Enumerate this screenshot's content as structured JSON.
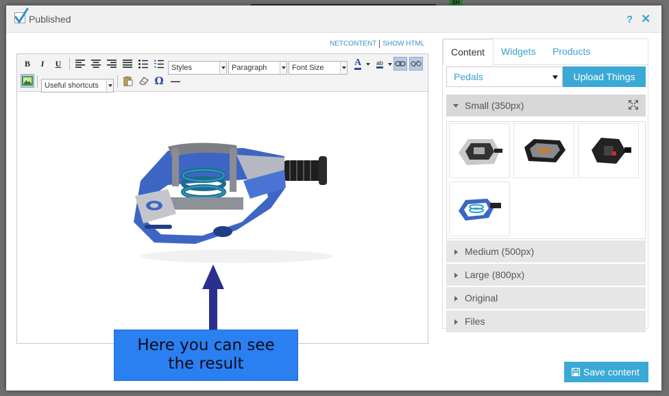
{
  "backdrop": {
    "badge": "SH"
  },
  "dialog": {
    "published_label": "Published",
    "help_symbol": "?",
    "close_symbol": "✕"
  },
  "editor": {
    "links": {
      "netcontent": "NETCONTENT",
      "show_html": "SHOW HTML"
    },
    "toolbar": {
      "bold": "B",
      "italic": "I",
      "underline": "U",
      "styles_combo": "Styles",
      "format_combo": "Paragraph",
      "font_size_combo": "Font Size",
      "font_color_glyph": "A",
      "highlight_glyph": "ab",
      "shortcuts_combo": "Useful shortcuts",
      "special_char": "Ω",
      "hr_glyph": "—"
    }
  },
  "callout": {
    "line1": "Here you can see",
    "line2": "the result"
  },
  "sidebar": {
    "tabs": [
      "Content",
      "Widgets",
      "Products"
    ],
    "category_select": "Pedals",
    "upload_button": "Upload Things",
    "sections": {
      "small": "Small (350px)",
      "medium": "Medium (500px)",
      "large": "Large (800px)",
      "original": "Original",
      "files": "Files"
    }
  },
  "save_button": "Save content",
  "colors": {
    "accent": "#3aa9d5",
    "callout": "#2a80f0",
    "arrow": "#2b2f8f",
    "pedal_blue": "#3d66c4"
  }
}
